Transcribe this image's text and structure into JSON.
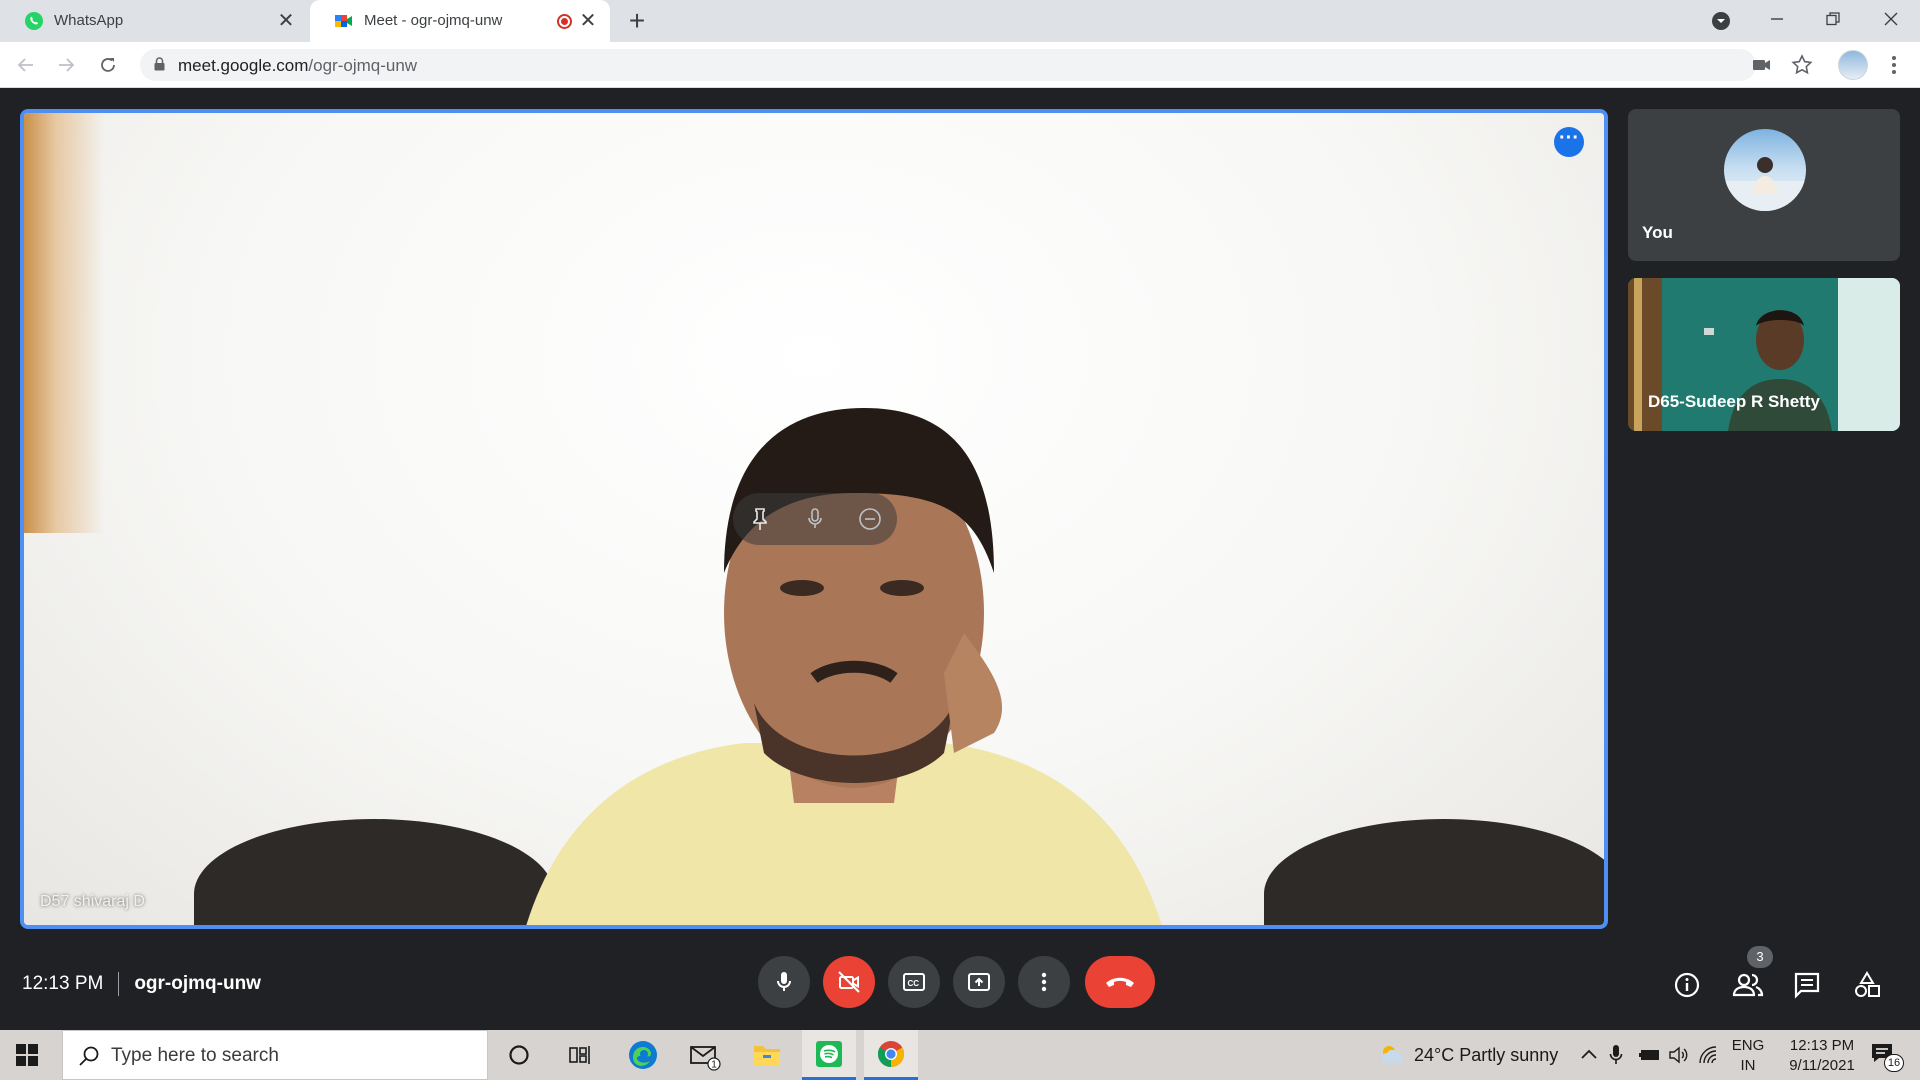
{
  "browser": {
    "tabs": [
      {
        "title": "WhatsApp",
        "active": false
      },
      {
        "title": "Meet - ogr-ojmq-unw",
        "active": true,
        "recording": true
      }
    ],
    "address": {
      "domain": "meet.google.com",
      "path": "/ogr-ojmq-unw"
    }
  },
  "meet": {
    "main_participant": "D57 shivaraj D",
    "tiles": [
      {
        "name": "You"
      },
      {
        "name": "D65-Sudeep R Shetty"
      }
    ],
    "time": "12:13 PM",
    "meeting_code": "ogr-ojmq-unw",
    "participant_count": "3",
    "colors": {
      "accent": "#1a73e8",
      "hangup": "#ea4335",
      "tile_border": "#4d8ff5"
    }
  },
  "taskbar": {
    "search_placeholder": "Type here to search",
    "mail_badge": "1",
    "weather": "24°C  Partly sunny",
    "lang_line1": "ENG",
    "lang_line2": "IN",
    "clock_time": "12:13 PM",
    "clock_date": "9/11/2021",
    "notification_count": "16"
  }
}
